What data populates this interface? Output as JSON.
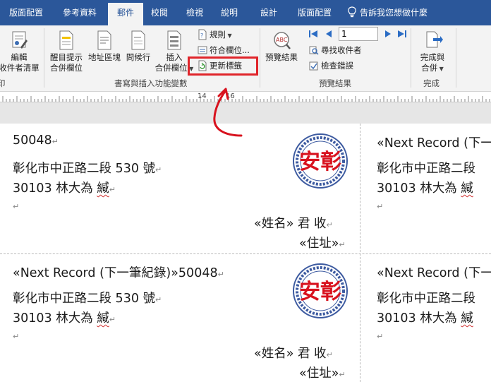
{
  "tabs": [
    {
      "label": "版面配置",
      "active": false
    },
    {
      "label": "參考資料",
      "active": false
    },
    {
      "label": "郵件",
      "active": true
    },
    {
      "label": "校閱",
      "active": false
    },
    {
      "label": "檢視",
      "active": false
    },
    {
      "label": "說明",
      "active": false
    },
    {
      "label": "設計",
      "active": false
    },
    {
      "label": "版面配置",
      "active": false
    }
  ],
  "tell_me": "告訴我您想做什麼",
  "ribbon": {
    "edit_recipients_line1": "編輯",
    "edit_recipients_line2": "收件者清單",
    "edit_recipients_partial": "印",
    "highlight_fields_line1": "醒目提示",
    "highlight_fields_line2": "合併欄位",
    "address_block": "地址區塊",
    "greeting_line": "問候行",
    "insert_field_line1": "插入",
    "insert_field_line2": "合併欄位",
    "rules": "規則",
    "match_fields": "符合欄位...",
    "update_labels": "更新標籤",
    "group_write_insert": "書寫與插入功能變數",
    "preview_results": "預覽結果",
    "record_number": "1",
    "find_recipient": "尋找收件者",
    "check_errors": "檢查錯誤",
    "group_preview": "預覽結果",
    "finish_merge_line1": "完成與",
    "finish_merge_line2": "合併",
    "group_finish": "完成"
  },
  "ruler": {
    "marks": [
      "14",
      "16"
    ]
  },
  "labels": [
    {
      "line1": "50048",
      "address": "彰化市中正路二段 530 號",
      "zip_name": "30103 林大為 ",
      "salutation_end": "緘",
      "name_field": "«姓名» 君 收",
      "address_field": "«住址»"
    },
    {
      "line1": "«Next Record (下一筆紀錄)»50048",
      "address": "彰化市中正路二段 530 號",
      "zip_name": "30103 林大為 ",
      "salutation_end": "緘",
      "name_field": "«姓名» 君 收",
      "address_field": "«住址»"
    }
  ],
  "right_column": {
    "line1": "«Next Record (下一",
    "address": "彰化市中正路二段",
    "zip_name": "30103 林大為 ",
    "salutation_end": "緘"
  },
  "stamp_text": "安彰",
  "colors": {
    "tabbar": "#2b579a",
    "ribbon": "#f3f3f3",
    "highlight": "#e0242a",
    "stamp_red": "#d8121e",
    "stamp_blue": "#3c5aa0"
  }
}
